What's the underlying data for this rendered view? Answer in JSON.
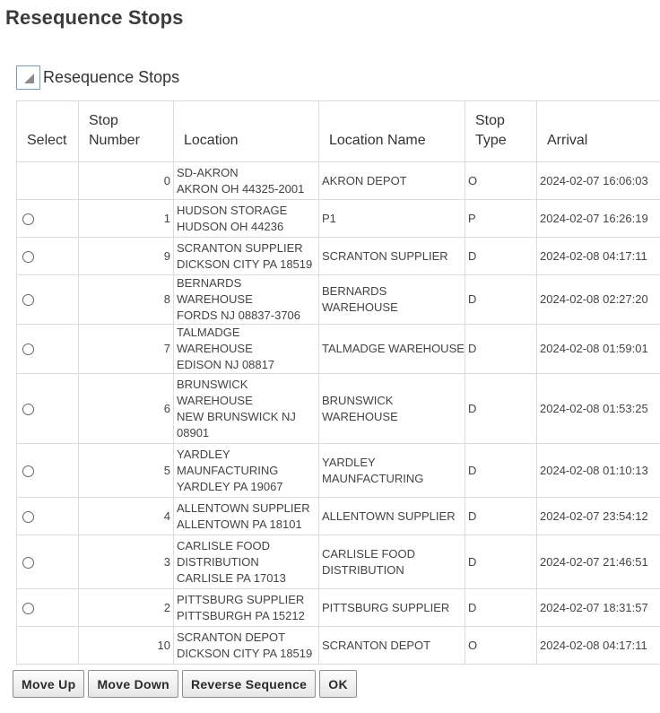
{
  "page": {
    "title": "Resequence Stops"
  },
  "section": {
    "title": "Resequence Stops",
    "toggle_icon": "collapse-triangle-icon"
  },
  "table": {
    "headers": {
      "select": "Select",
      "stop_number": [
        "Stop",
        "Number"
      ],
      "location": "Location",
      "location_name": "Location Name",
      "stop_type": [
        "Stop",
        "Type"
      ],
      "arrival": "Arrival"
    },
    "rows": [
      {
        "radio": false,
        "stop_number": "0",
        "location": [
          "SD-AKRON",
          "AKRON OH 44325-2001"
        ],
        "location_name": [
          "AKRON DEPOT"
        ],
        "stop_type": "O",
        "arrival": "2024-02-07 16:06:03"
      },
      {
        "radio": true,
        "stop_number": "1",
        "location": [
          "HUDSON STORAGE",
          "HUDSON OH 44236"
        ],
        "location_name": [
          "P1"
        ],
        "stop_type": "P",
        "arrival": "2024-02-07 16:26:19"
      },
      {
        "radio": true,
        "stop_number": "9",
        "location": [
          "SCRANTON SUPPLIER",
          "DICKSON CITY PA 18519"
        ],
        "location_name": [
          "SCRANTON SUPPLIER"
        ],
        "stop_type": "D",
        "arrival": "2024-02-08 04:17:11"
      },
      {
        "radio": true,
        "stop_number": "8",
        "location": [
          "BERNARDS WAREHOUSE",
          "FORDS NJ 08837-3706"
        ],
        "location_name": [
          "BERNARDS WAREHOUSE"
        ],
        "stop_type": "D",
        "arrival": "2024-02-08 02:27:20"
      },
      {
        "radio": true,
        "stop_number": "7",
        "location": [
          "TALMADGE WAREHOUSE",
          "EDISON NJ 08817"
        ],
        "location_name": [
          "TALMADGE WAREHOUSE"
        ],
        "stop_type": "D",
        "arrival": "2024-02-08 01:59:01"
      },
      {
        "radio": true,
        "stop_number": "6",
        "location": [
          "BRUNSWICK",
          "WAREHOUSE",
          "NEW BRUNSWICK NJ",
          "08901"
        ],
        "location_name": [
          "BRUNSWICK",
          "WAREHOUSE"
        ],
        "stop_type": "D",
        "arrival": "2024-02-08 01:53:25"
      },
      {
        "radio": true,
        "stop_number": "5",
        "location": [
          "YARDLEY",
          "MAUNFACTURING",
          "YARDLEY PA 19067"
        ],
        "location_name": [
          "YARDLEY",
          "MAUNFACTURING"
        ],
        "stop_type": "D",
        "arrival": "2024-02-08 01:10:13"
      },
      {
        "radio": true,
        "stop_number": "4",
        "location": [
          "ALLENTOWN SUPPLIER",
          "ALLENTOWN PA 18101"
        ],
        "location_name": [
          "ALLENTOWN SUPPLIER"
        ],
        "stop_type": "D",
        "arrival": "2024-02-07 23:54:12"
      },
      {
        "radio": true,
        "stop_number": "3",
        "location": [
          "CARLISLE FOOD",
          "DISTRIBUTION",
          "CARLISLE PA 17013"
        ],
        "location_name": [
          "CARLISLE FOOD",
          "DISTRIBUTION"
        ],
        "stop_type": "D",
        "arrival": "2024-02-07 21:46:51"
      },
      {
        "radio": true,
        "stop_number": "2",
        "location": [
          "PITTSBURG SUPPLIER",
          "PITTSBURGH PA 15212"
        ],
        "location_name": [
          "PITTSBURG SUPPLIER"
        ],
        "stop_type": "D",
        "arrival": "2024-02-07 18:31:57"
      },
      {
        "radio": false,
        "stop_number": "10",
        "location": [
          "SCRANTON DEPOT",
          "DICKSON CITY PA 18519"
        ],
        "location_name": [
          "SCRANTON DEPOT"
        ],
        "stop_type": "O",
        "arrival": "2024-02-08 04:17:11"
      }
    ]
  },
  "buttons": {
    "move_up": "Move Up",
    "move_down": "Move Down",
    "reverse_sequence": "Reverse Sequence",
    "ok": "OK"
  }
}
